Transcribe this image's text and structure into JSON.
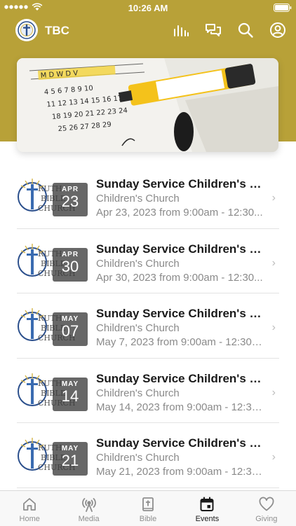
{
  "status_bar": {
    "time": "10:26 AM"
  },
  "app_bar": {
    "title": "TBC",
    "logo_text": "TBC"
  },
  "events": [
    {
      "month": "APR",
      "day": "23",
      "title": "Sunday Service Children's C...",
      "category": "Children's Church",
      "when": "Apr 23, 2023 from 9:00am - 12:30..."
    },
    {
      "month": "APR",
      "day": "30",
      "title": "Sunday Service Children's C...",
      "category": "Children's Church",
      "when": "Apr 30, 2023 from 9:00am - 12:30..."
    },
    {
      "month": "MAY",
      "day": "07",
      "title": "Sunday Service Children's C...",
      "category": "Children's Church",
      "when": "May 7, 2023 from 9:00am - 12:30p..."
    },
    {
      "month": "MAY",
      "day": "14",
      "title": "Sunday Service Children's C...",
      "category": "Children's Church",
      "when": "May 14, 2023 from 9:00am - 12:30..."
    },
    {
      "month": "MAY",
      "day": "21",
      "title": "Sunday Service Children's C...",
      "category": "Children's Church",
      "when": "May 21, 2023 from 9:00am - 12:30..."
    }
  ],
  "tabs": [
    {
      "label": "Home",
      "icon": "home-icon",
      "active": false
    },
    {
      "label": "Media",
      "icon": "broadcast-icon",
      "active": false
    },
    {
      "label": "Bible",
      "icon": "bible-icon",
      "active": false
    },
    {
      "label": "Events",
      "icon": "calendar-icon",
      "active": true
    },
    {
      "label": "Giving",
      "icon": "heart-icon",
      "active": false
    }
  ],
  "colors": {
    "brand": "#b8a138",
    "logo_gold": "#d6b64a",
    "logo_blue": "#2b4f8c"
  }
}
